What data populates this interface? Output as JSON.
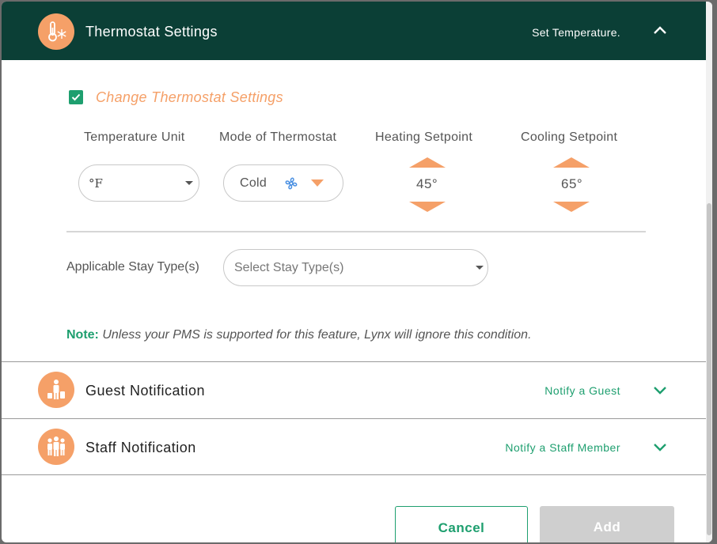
{
  "header": {
    "title": "Thermostat Settings",
    "subtitle": "Set Temperature.",
    "icon": "thermometer-snowflake-icon"
  },
  "change_settings": {
    "label": "Change Thermostat Settings",
    "checked": true
  },
  "columns": {
    "unit_label": "Temperature Unit",
    "mode_label": "Mode of Thermostat",
    "heating_label": "Heating Setpoint",
    "cooling_label": "Cooling Setpoint"
  },
  "unit": {
    "value": "°F"
  },
  "mode": {
    "value": "Cold",
    "icon": "fan-icon"
  },
  "heating": {
    "value": "45°"
  },
  "cooling": {
    "value": "65°"
  },
  "stay": {
    "label": "Applicable Stay Type(s)",
    "placeholder": "Select Stay Type(s)"
  },
  "note": {
    "key": "Note:",
    "text": " Unless your PMS is supported for this feature, Lynx will ignore this condition."
  },
  "guest": {
    "title": "Guest Notification",
    "subtitle": "Notify a Guest",
    "icon": "guest-luggage-icon"
  },
  "staff": {
    "title": "Staff Notification",
    "subtitle": "Notify a Staff Member",
    "icon": "staff-group-icon"
  },
  "footer": {
    "cancel_label": "Cancel",
    "add_label": "Add"
  },
  "colors": {
    "header_bg": "#0b3f36",
    "accent_orange": "#f5a068",
    "accent_green": "#1e9f6f"
  }
}
